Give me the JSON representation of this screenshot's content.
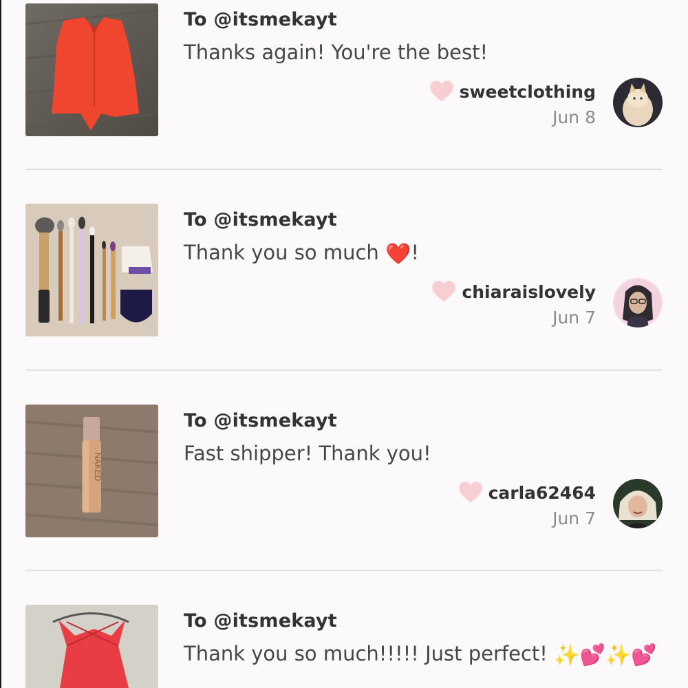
{
  "feed": {
    "items": [
      {
        "to": "To @itsmekayt",
        "message": "Thanks again! You're the best!",
        "username": "sweetclothing",
        "date": "Jun 8",
        "thumb_desc": "red-top"
      },
      {
        "to": "To @itsmekayt",
        "message": "Thank you so much ",
        "message_emoji": "❤️",
        "message_tail": "!",
        "username": "chiaraislovely",
        "date": "Jun 7",
        "thumb_desc": "makeup-brushes"
      },
      {
        "to": "To @itsmekayt",
        "message": "Fast shipper! Thank you!",
        "username": "carla62464",
        "date": "Jun 7",
        "thumb_desc": "foundation-bottle"
      },
      {
        "to": "To @itsmekayt",
        "message": "Thank you so much!!!!! Just perfect! ",
        "message_emoji": "✨💕✨💕",
        "username": "",
        "date": "",
        "thumb_desc": "red-dress"
      }
    ]
  },
  "colors": {
    "background": "#fbf9fa",
    "heart": "#f7cfd3",
    "divider": "#e4e2e3"
  },
  "icons": [
    "heart-icon"
  ]
}
